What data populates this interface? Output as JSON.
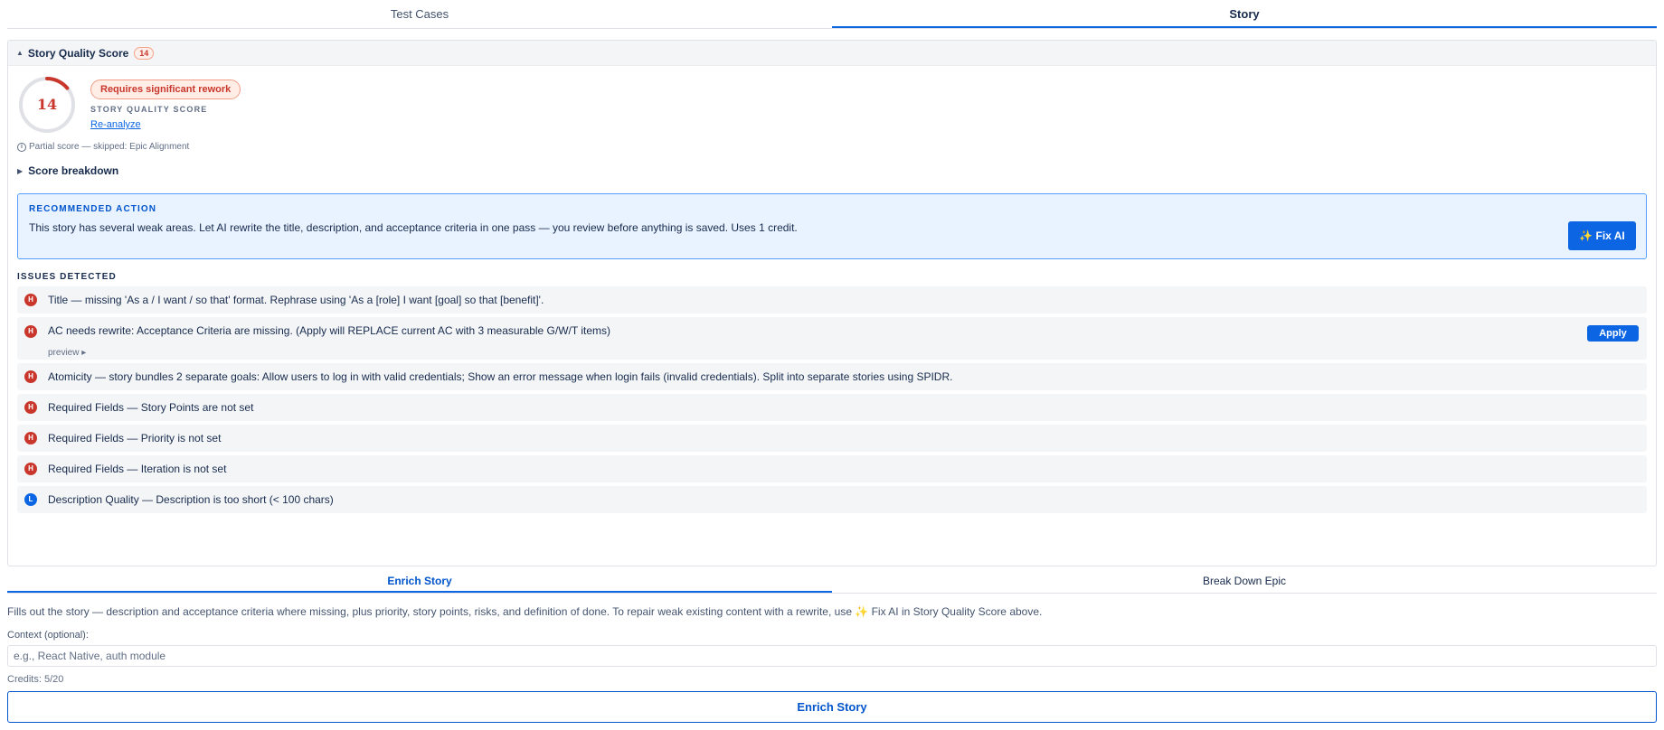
{
  "tabs": [
    {
      "label": "Test Cases",
      "active": false
    },
    {
      "label": "Story",
      "active": true
    }
  ],
  "quality": {
    "header_title": "Story Quality Score",
    "header_badge": "14",
    "score": "14",
    "score_value": 14,
    "score_max": 100,
    "verdict": "Requires significant rework",
    "caption": "STORY QUALITY SCORE",
    "reanalyze": "Re-analyze",
    "partial_note": "Partial score — skipped: Epic Alignment",
    "breakdown_label": "Score breakdown",
    "colors": {
      "danger": "#c9372c",
      "accent": "#0c66e4",
      "ring_track": "#dfe1e6"
    }
  },
  "recommendation": {
    "label": "RECOMMENDED ACTION",
    "text": "This story has several weak areas. Let AI rewrite the title, description, and acceptance criteria in one pass — you review before anything is saved. Uses 1 credit.",
    "button": "✨ Fix AI"
  },
  "issues_label": "ISSUES DETECTED",
  "issues": [
    {
      "severity": "H",
      "text": "Title — missing 'As a / I want / so that' format. Rephrase using 'As a [role] I want [goal] so that [benefit]'."
    },
    {
      "severity": "H",
      "text": "AC needs rewrite: Acceptance Criteria are missing. (Apply will REPLACE current AC with 3 measurable G/W/T items)",
      "preview": "preview ▸",
      "action": "Apply"
    },
    {
      "severity": "H",
      "text": "Atomicity — story bundles 2 separate goals: Allow users to log in with valid credentials; Show an error message when login fails (invalid credentials). Split into separate stories using SPIDR."
    },
    {
      "severity": "H",
      "text": "Required Fields — Story Points are not set"
    },
    {
      "severity": "H",
      "text": "Required Fields — Priority is not set"
    },
    {
      "severity": "H",
      "text": "Required Fields — Iteration is not set"
    },
    {
      "severity": "L",
      "text": "Description Quality — Description is too short (< 100 chars)"
    }
  ],
  "sub_tabs": [
    {
      "label": "Enrich Story",
      "active": true
    },
    {
      "label": "Break Down Epic",
      "active": false
    }
  ],
  "enrich": {
    "description": "Fills out the story — description and acceptance criteria where missing, plus priority, story points, risks, and definition of done. To repair weak existing content with a rewrite, use ✨ Fix AI in Story Quality Score above.",
    "context_label": "Context (optional):",
    "context_placeholder": "e.g., React Native, auth module",
    "context_value": "",
    "credits": "Credits: 5/20",
    "button": "Enrich Story"
  }
}
